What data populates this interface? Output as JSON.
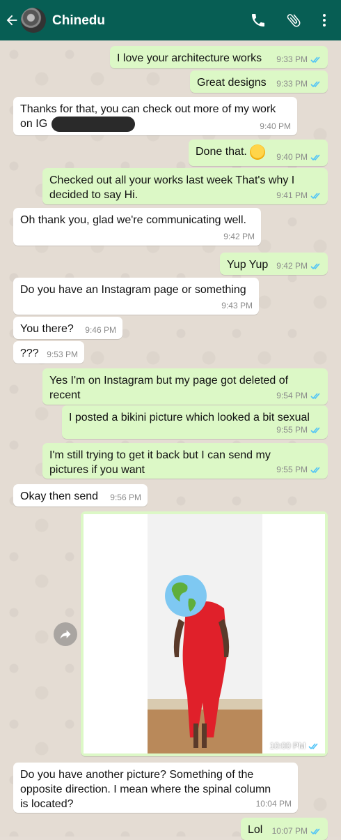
{
  "header": {
    "contact_name": "Chinedu"
  },
  "icons": {
    "back": "arrow-left-icon",
    "call": "phone-icon",
    "attach": "paperclip-icon",
    "menu": "more-vertical-icon",
    "read": "double-check-icon",
    "forward": "forward-icon",
    "emoji": "smiling-face-icon",
    "globe": "globe-icon"
  },
  "colors": {
    "header": "#075e54",
    "outgoing": "#dcf8c6",
    "incoming": "#ffffff",
    "read_tick": "#4fc3f7"
  },
  "messages": [
    {
      "dir": "out",
      "text": "I love your architecture works",
      "time": "9:33 PM"
    },
    {
      "dir": "out",
      "text": "Great designs",
      "time": "9:33 PM"
    },
    {
      "dir": "in",
      "text": "Thanks for that, you can check out more of my work\non IG",
      "time": "9:40 PM"
    },
    {
      "dir": "out",
      "text": "Done that.",
      "time": "9:40 PM"
    },
    {
      "dir": "out",
      "text": "Checked out all your works last week That's why I\ndecided to say Hi.",
      "time": "9:41 PM"
    },
    {
      "dir": "in",
      "text": "Oh thank you, glad we're communicating well.",
      "time": "9:42 PM"
    },
    {
      "dir": "out",
      "text": "Yup Yup",
      "time": "9:42 PM"
    },
    {
      "dir": "in",
      "text": "Do you have an Instagram page or something",
      "time": "9:43 PM"
    },
    {
      "dir": "in",
      "text": "You there?",
      "time": "9:46 PM"
    },
    {
      "dir": "in",
      "text": "???",
      "time": "9:53 PM"
    },
    {
      "dir": "out",
      "text": "Yes I'm on Instagram but my page got deleted of\nrecent",
      "time": "9:54 PM"
    },
    {
      "dir": "out",
      "text": "I posted a bikini picture which looked a bit sexual",
      "time": "9:55 PM"
    },
    {
      "dir": "out",
      "text": "I'm still trying to get it back but I can send my\npictures if you want",
      "time": "9:55 PM"
    },
    {
      "dir": "in",
      "text": "Okay then send",
      "time": "9:56 PM"
    },
    {
      "dir": "out",
      "type": "image",
      "time": "10:00 PM"
    },
    {
      "dir": "in",
      "text": "Do you have another picture? Something of the\nopposite direction. I mean where the spinal column\nis located?",
      "time": "10:04 PM"
    },
    {
      "dir": "out",
      "text": "Lol",
      "time": "10:07 PM"
    }
  ]
}
